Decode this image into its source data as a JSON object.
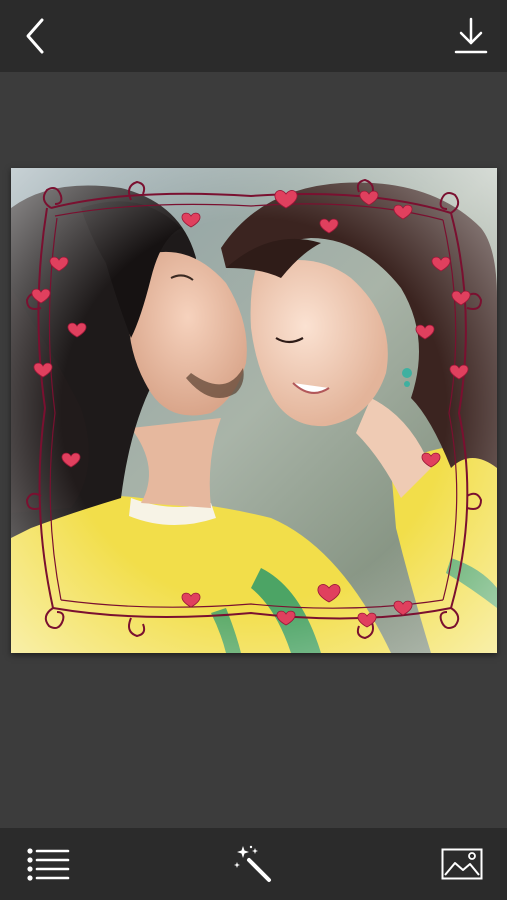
{
  "header": {
    "back_icon": "chevron-left-icon",
    "download_icon": "download-icon"
  },
  "photo": {
    "frame_style": "heart-vine-border",
    "colors": {
      "frame_line": "#7a1030",
      "heart": "#e0405e",
      "shirt": "#f2de4a"
    }
  },
  "toolbar": {
    "menu_icon": "list-menu-icon",
    "effects_icon": "magic-wand-icon",
    "gallery_icon": "image-gallery-icon"
  },
  "theme": {
    "bar_bg": "#2b2b2b",
    "canvas_bg": "#3c3c3c",
    "icon_color": "#ffffff"
  }
}
